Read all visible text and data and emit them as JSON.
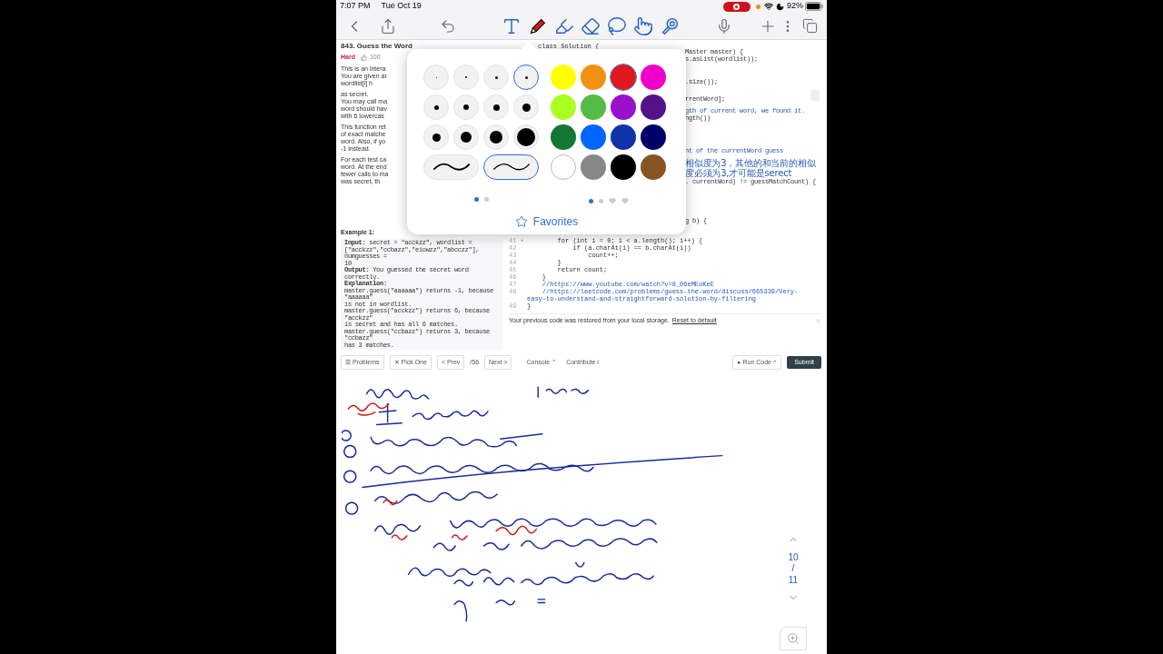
{
  "status_bar": {
    "time": "7:07 PM",
    "date": "Tue Oct 19",
    "battery": "92%"
  },
  "toolbar": {
    "tools": [
      {
        "kind": "text",
        "selected": false
      },
      {
        "kind": "pen",
        "selected": true
      },
      {
        "kind": "highlighter",
        "selected": false
      },
      {
        "kind": "eraser",
        "selected": false
      },
      {
        "kind": "lasso",
        "selected": false
      },
      {
        "kind": "hand",
        "selected": false
      },
      {
        "kind": "magnifier",
        "selected": false
      }
    ]
  },
  "problem": {
    "title": "843. Guess the Word",
    "difficulty": "Hard",
    "likes": "100",
    "fragments": [
      "This is an intera",
      "You are given ar",
      "wordlist[i] h",
      "as secret.",
      "You may call ma",
      "word should hav",
      "with 6 lowercas",
      "This function ret",
      "of exact matche",
      "word. Also, if yo",
      "-1 instead.",
      "For each test ca",
      "word. At the end",
      "fewer calls to ma",
      "was secret, th"
    ],
    "example_title": "Example 1:",
    "example_lines": [
      "**Input:** secret = \"acckzz\", wordlist =",
      "[\"acckzz\",\"ccbazz\",\"eiowzz\",\"abcczz\"], numguesses =",
      "10",
      "**Output:** You guessed the secret word correctly.",
      "**Explanation:**",
      "master.guess(\"aaaaaa\") returns -1, because \"aaaaaa\"",
      "is not in wordlist.",
      "master.guess(\"acckzz\") returns 6, because \"acckzz\"",
      "is secret and has all 6 matches.",
      "master.guess(\"ccbazz\") returns 3, because \"ccbazz\"",
      "has 3 matches."
    ]
  },
  "code": {
    "header": "class Solution {",
    "fragments": [
      {
        "text": "Master master) {",
        "comment": false
      },
      {
        "text": "s.asList(wordlist));",
        "comment": false
      },
      {
        "text": ".size());",
        "comment": false
      },
      {
        "text": "rrentWord];",
        "comment": false
      },
      {
        "text": "gth of current word, we found it.",
        "comment": true
      },
      {
        "text": "ngth())",
        "comment": false
      },
      {
        "text": "nt of the currentWord guess",
        "comment": true
      },
      {
        "text": "相似度为3，其他的和当前的相似度必须为3,才可能是serect",
        "comment": true
      },
      {
        "text": ". currentWord) != guessMatchCount) {",
        "comment": false
      },
      {
        "text": "g b) {",
        "comment": false
      }
    ],
    "lines": [
      {
        "number": "41 ▾",
        "text": "        for (int i = 0; i < a.length(); i++) {",
        "comment": false
      },
      {
        "number": "42",
        "text": "            if (a.charAt(i) == b.charAt(i))",
        "comment": false
      },
      {
        "number": "43",
        "text": "                count++;",
        "comment": false
      },
      {
        "number": "44",
        "text": "        }",
        "comment": false
      },
      {
        "number": "45",
        "text": "        return count;",
        "comment": false
      },
      {
        "number": "46",
        "text": "    }",
        "comment": false
      },
      {
        "number": "47",
        "text": "    //https://www.youtube.com/watch?v=8_06eMEoKeE",
        "comment": true
      },
      {
        "number": "48",
        "text": "    //https://leetcode.com/problems/guess-the-word/discuss/665339/Very-easy-to-understand-and-straightforward-solution-by-filtering",
        "comment": true
      },
      {
        "number": "49",
        "text": "}",
        "comment": false
      }
    ],
    "notice": "Your previous code was restored from your local storage.",
    "reset_link": "Reset to default"
  },
  "bottom_bar": {
    "problems": "☰ Problems",
    "pick_one": "✕ Pick One",
    "prev": "< Prev",
    "counter": "/56",
    "next": "Next >",
    "console": "Console ⌃",
    "contribute": "Contribute i",
    "run_code": "▸ Run Code ^",
    "submit": "Submit"
  },
  "popover": {
    "sizes": [
      {
        "selected": false
      },
      {
        "selected": false
      },
      {
        "selected": false
      },
      {
        "selected": true
      },
      {
        "selected": false
      },
      {
        "selected": false
      },
      {
        "selected": false
      },
      {
        "selected": false
      },
      {
        "selected": false
      },
      {
        "selected": false
      },
      {
        "selected": false
      },
      {
        "selected": false
      }
    ],
    "strokes": [
      {
        "selected": false
      },
      {
        "selected": true
      }
    ],
    "size_pages": [
      {
        "selected": true
      },
      {
        "selected": false
      }
    ],
    "colors": [
      {
        "color": "#ffff00",
        "selected": false
      },
      {
        "color": "#f39212",
        "selected": false
      },
      {
        "color": "#e0171b",
        "selected": true
      },
      {
        "color": "#ee00cc",
        "selected": false
      },
      {
        "color": "#aaff22",
        "selected": false
      },
      {
        "color": "#55bb44",
        "selected": false
      },
      {
        "color": "#9911cc",
        "selected": false
      },
      {
        "color": "#551188",
        "selected": false
      },
      {
        "color": "#117733",
        "selected": false
      },
      {
        "color": "#0066ff",
        "selected": false
      },
      {
        "color": "#1133aa",
        "selected": false
      },
      {
        "color": "#000066",
        "selected": false
      },
      {
        "color": "#ffffff",
        "selected": false
      },
      {
        "color": "#888888",
        "selected": false
      },
      {
        "color": "#000000",
        "selected": false
      },
      {
        "color": "#885522",
        "selected": false
      }
    ],
    "color_pages": [
      {
        "kind": "dot",
        "selected": true
      },
      {
        "kind": "dot",
        "selected": false
      },
      {
        "kind": "heart",
        "selected": false
      },
      {
        "kind": "heart",
        "selected": false
      }
    ],
    "favorites": "Favorites"
  },
  "page_indicator": {
    "current": "10",
    "separator": "/",
    "total": "11"
  }
}
